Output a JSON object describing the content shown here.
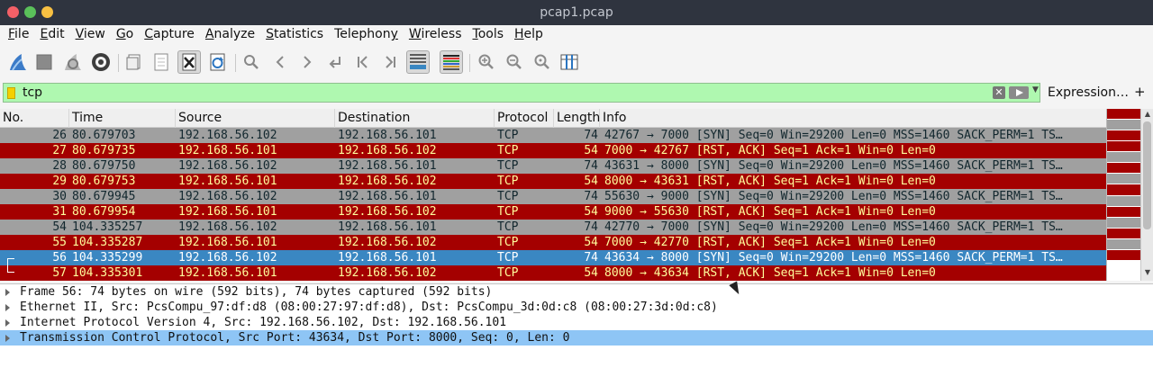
{
  "window": {
    "title": "pcap1.pcap"
  },
  "menu": [
    {
      "label": "File",
      "ul": "F",
      "rest": "ile"
    },
    {
      "label": "Edit",
      "ul": "E",
      "rest": "dit"
    },
    {
      "label": "View",
      "ul": "V",
      "rest": "iew"
    },
    {
      "label": "Go",
      "ul": "G",
      "rest": "o"
    },
    {
      "label": "Capture",
      "ul": "C",
      "rest": "apture"
    },
    {
      "label": "Analyze",
      "ul": "A",
      "rest": "nalyze"
    },
    {
      "label": "Statistics",
      "ul": "S",
      "rest": "tatistics"
    },
    {
      "label": "Telephony",
      "ul": "y",
      "rest": "Telephon"
    },
    {
      "label": "Wireless",
      "ul": "W",
      "rest": "ireless"
    },
    {
      "label": "Tools",
      "ul": "T",
      "rest": "ools"
    },
    {
      "label": "Help",
      "ul": "H",
      "rest": "elp"
    }
  ],
  "toolbar": {
    "icons": [
      "shark-fin-icon",
      "stop-square-icon",
      "restart-fin-icon",
      "gear-icon",
      "open-file-icon",
      "file-icon",
      "close-file-icon",
      "reload-icon",
      "search-icon",
      "arrow-left-icon",
      "arrow-right-icon",
      "go-to-packet-icon",
      "first-packet-icon",
      "last-packet-icon",
      "autoscroll-icon",
      "colorize-icon",
      "zoom-in-icon",
      "zoom-out-icon",
      "zoom-normal-icon",
      "resize-columns-icon"
    ]
  },
  "filter": {
    "value": "tcp",
    "expression_label": "Expression…",
    "plus_label": "+",
    "clear_glyph": "✕",
    "dropdown_glyph": "▼"
  },
  "packet_list": {
    "columns": [
      "No.",
      "Time",
      "Source",
      "Destination",
      "Protocol",
      "Length",
      "Info"
    ],
    "rows": [
      {
        "no": "26",
        "time": "80.679703",
        "src": "192.168.56.102",
        "dst": "192.168.56.101",
        "proto": "TCP",
        "len": "74",
        "info": "42767 → 7000 [SYN] Seq=0 Win=29200 Len=0 MSS=1460 SACK_PERM=1 TS…",
        "style": "gray"
      },
      {
        "no": "27",
        "time": "80.679735",
        "src": "192.168.56.101",
        "dst": "192.168.56.102",
        "proto": "TCP",
        "len": "54",
        "info": "7000 → 42767 [RST, ACK] Seq=1 Ack=1 Win=0 Len=0",
        "style": "red"
      },
      {
        "no": "28",
        "time": "80.679750",
        "src": "192.168.56.102",
        "dst": "192.168.56.101",
        "proto": "TCP",
        "len": "74",
        "info": "43631 → 8000 [SYN] Seq=0 Win=29200 Len=0 MSS=1460 SACK_PERM=1 TS…",
        "style": "gray"
      },
      {
        "no": "29",
        "time": "80.679753",
        "src": "192.168.56.101",
        "dst": "192.168.56.102",
        "proto": "TCP",
        "len": "54",
        "info": "8000 → 43631 [RST, ACK] Seq=1 Ack=1 Win=0 Len=0",
        "style": "red"
      },
      {
        "no": "30",
        "time": "80.679945",
        "src": "192.168.56.102",
        "dst": "192.168.56.101",
        "proto": "TCP",
        "len": "74",
        "info": "55630 → 9000 [SYN] Seq=0 Win=29200 Len=0 MSS=1460 SACK_PERM=1 TS…",
        "style": "gray"
      },
      {
        "no": "31",
        "time": "80.679954",
        "src": "192.168.56.101",
        "dst": "192.168.56.102",
        "proto": "TCP",
        "len": "54",
        "info": "9000 → 55630 [RST, ACK] Seq=1 Ack=1 Win=0 Len=0",
        "style": "red"
      },
      {
        "no": "54",
        "time": "104.335257",
        "src": "192.168.56.102",
        "dst": "192.168.56.101",
        "proto": "TCP",
        "len": "74",
        "info": "42770 → 7000 [SYN] Seq=0 Win=29200 Len=0 MSS=1460 SACK_PERM=1 TS…",
        "style": "gray"
      },
      {
        "no": "55",
        "time": "104.335287",
        "src": "192.168.56.101",
        "dst": "192.168.56.102",
        "proto": "TCP",
        "len": "54",
        "info": "7000 → 42770 [RST, ACK] Seq=1 Ack=1 Win=0 Len=0",
        "style": "red"
      },
      {
        "no": "56",
        "time": "104.335299",
        "src": "192.168.56.102",
        "dst": "192.168.56.101",
        "proto": "TCP",
        "len": "74",
        "info": "43634 → 8000 [SYN] Seq=0 Win=29200 Len=0 MSS=1460 SACK_PERM=1 TS…",
        "style": "sel"
      },
      {
        "no": "57",
        "time": "104.335301",
        "src": "192.168.56.101",
        "dst": "192.168.56.102",
        "proto": "TCP",
        "len": "54",
        "info": "8000 → 43634 [RST, ACK] Seq=1 Ack=1 Win=0 Len=0",
        "style": "red"
      }
    ]
  },
  "minimap": {
    "pattern": [
      "red",
      "gray",
      "red",
      "red",
      "gray",
      "red",
      "gray",
      "red",
      "gray",
      "red",
      "gray",
      "red",
      "gray",
      "red",
      "sel"
    ]
  },
  "details": [
    {
      "text": "Frame 56: 74 bytes on wire (592 bits), 74 bytes captured (592 bits)",
      "selected": false
    },
    {
      "text": "Ethernet II, Src: PcsCompu_97:df:d8 (08:00:27:97:df:d8), Dst: PcsCompu_3d:0d:c8 (08:00:27:3d:0d:c8)",
      "selected": false
    },
    {
      "text": "Internet Protocol Version 4, Src: 192.168.56.102, Dst: 192.168.56.101",
      "selected": false
    },
    {
      "text": "Transmission Control Protocol, Src Port: 43634, Dst Port: 8000, Seq: 0, Len: 0",
      "selected": true
    }
  ],
  "colors": {
    "row_gray": "#a0a0a0",
    "row_red": "#a40000",
    "row_red_text": "#fffc9c",
    "row_selected": "#3a87c2",
    "filter_valid": "#aff8b0",
    "detail_selected": "#8ec5f5"
  }
}
